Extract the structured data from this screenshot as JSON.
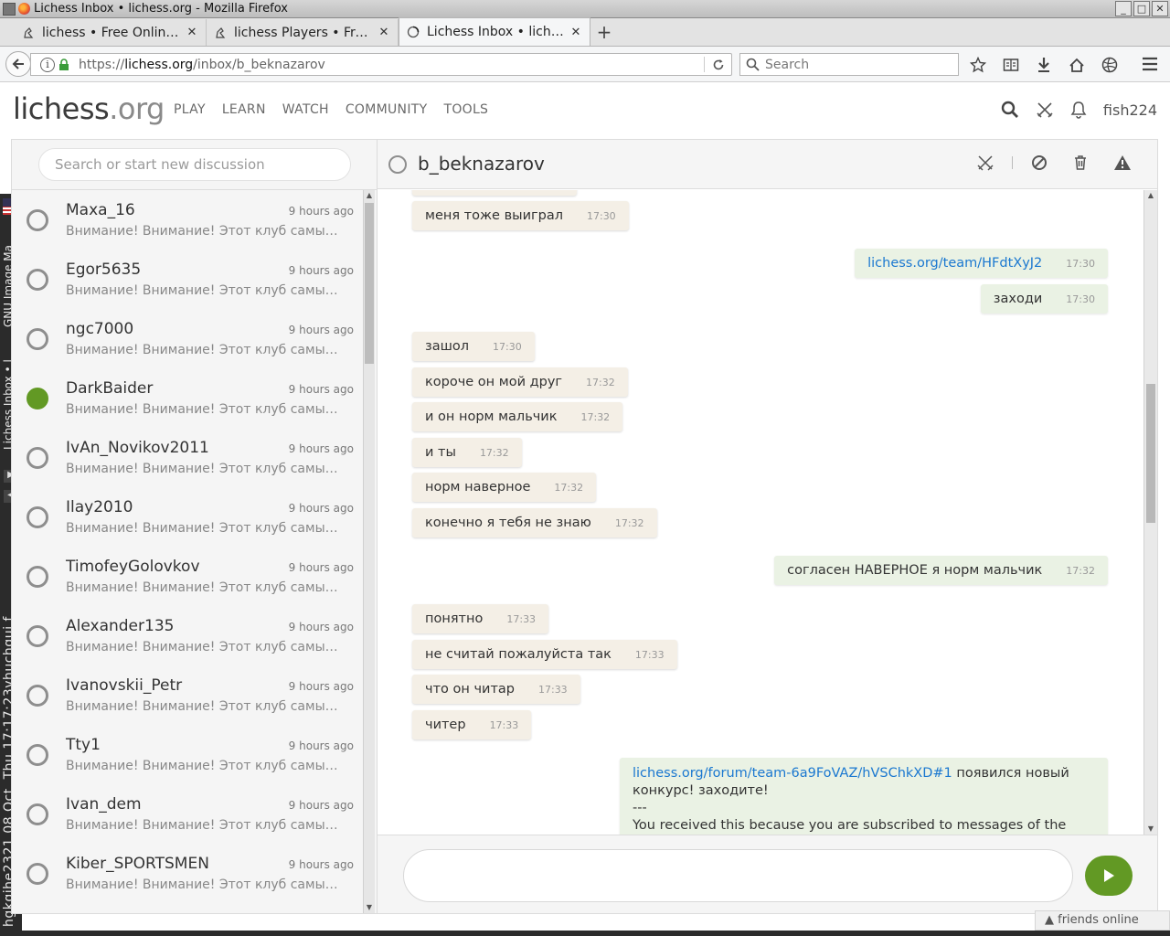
{
  "window": {
    "title": "Lichess Inbox • lichess.org - Mozilla Firefox"
  },
  "tabs": [
    {
      "label": "lichess • Free Online ..."
    },
    {
      "label": "lichess Players • Free..."
    },
    {
      "label": "Lichess Inbox • liches..."
    }
  ],
  "navbar": {
    "url_prefix": "https://",
    "url_host": "lichess.org",
    "url_path": "/inbox/b_beknazarov",
    "search_placeholder": "Search"
  },
  "taskstrip": {
    "window_label": "Lichess Inbox • l",
    "app_label": "GNU Image Ma",
    "clock": "hgkgjhe2321 08 Oct, Thu 17:17:23vhuchgui.f"
  },
  "site": {
    "logo_main": "lichess",
    "logo_tld": ".org",
    "nav": [
      "PLAY",
      "LEARN",
      "WATCH",
      "COMMUNITY",
      "TOOLS"
    ],
    "username": "fish224"
  },
  "sidebar": {
    "search_placeholder": "Search or start new discussion",
    "contacts": [
      {
        "name": "Maxa_16",
        "time": "9 hours ago",
        "preview": "Внимание! Внимание! Этот клуб самый больш",
        "online": false
      },
      {
        "name": "Egor5635",
        "time": "9 hours ago",
        "preview": "Внимание! Внимание! Этот клуб самый больш",
        "online": false
      },
      {
        "name": "ngc7000",
        "time": "9 hours ago",
        "preview": "Внимание! Внимание! Этот клуб самый больш",
        "online": false
      },
      {
        "name": "DarkBaider",
        "time": "9 hours ago",
        "preview": "Внимание! Внимание! Этот клуб самый больш",
        "online": true
      },
      {
        "name": "IvAn_Novikov2011",
        "time": "9 hours ago",
        "preview": "Внимание! Внимание! Этот клуб самый больш",
        "online": false
      },
      {
        "name": "Ilay2010",
        "time": "9 hours ago",
        "preview": "Внимание! Внимание! Этот клуб самый больш",
        "online": false
      },
      {
        "name": "TimofeyGolovkov",
        "time": "9 hours ago",
        "preview": "Внимание! Внимание! Этот клуб самый больш",
        "online": false
      },
      {
        "name": "Alexander135",
        "time": "9 hours ago",
        "preview": "Внимание! Внимание! Этот клуб самый больш",
        "online": false
      },
      {
        "name": "Ivanovskii_Petr",
        "time": "9 hours ago",
        "preview": "Внимание! Внимание! Этот клуб самый больш",
        "online": false
      },
      {
        "name": "Tty1",
        "time": "9 hours ago",
        "preview": "Внимание! Внимание! Этот клуб самый больш",
        "online": false
      },
      {
        "name": "Ivan_dem",
        "time": "9 hours ago",
        "preview": "Внимание! Внимание! Этот клуб самый больш",
        "online": false
      },
      {
        "name": "Kiber_SPORTSMEN",
        "time": "9 hours ago",
        "preview": "Внимание! Внимание! Этот клуб самый больш",
        "online": false
      }
    ]
  },
  "conversation": {
    "username": "b_beknazarov",
    "messages": [
      {
        "dir": "in",
        "text": "меня тоже выиграл",
        "time": "17:30"
      },
      {
        "dir": "out",
        "link": "lichess.org/team/HFdtXyJ2",
        "time": "17:30"
      },
      {
        "dir": "out",
        "text": "заходи",
        "time": "17:30"
      },
      {
        "dir": "in",
        "text": "зашол",
        "time": "17:30"
      },
      {
        "dir": "in",
        "text": "короче он мой друг",
        "time": "17:32"
      },
      {
        "dir": "in",
        "text": "и он норм мальчик",
        "time": "17:32"
      },
      {
        "dir": "in",
        "text": "и ты",
        "time": "17:32"
      },
      {
        "dir": "in",
        "text": "норм наверное",
        "time": "17:32"
      },
      {
        "dir": "in",
        "text": "конечно я тебя не знаю",
        "time": "17:32"
      },
      {
        "dir": "out",
        "text": "согласен НАВЕРНОЕ я норм мальчик",
        "time": "17:32"
      },
      {
        "dir": "in",
        "text": "понятно",
        "time": "17:33"
      },
      {
        "dir": "in",
        "text": "не считай пожалуйста так",
        "time": "17:33"
      },
      {
        "dir": "in",
        "text": "что он читар",
        "time": "17:33"
      },
      {
        "dir": "in",
        "text": "читер",
        "time": "17:33"
      }
    ],
    "last_message": {
      "link": "lichess.org/forum/team-6a9FoVAZ/hVSChkXD#1",
      "text_after_link": " появился новый конкурс! заходите!",
      "separator": "---",
      "footer": "You received this because you are subscribed to messages of the team"
    }
  },
  "friends_online": "friends online",
  "colors": {
    "accent_green": "#629924",
    "link_blue": "#1b78d0"
  }
}
